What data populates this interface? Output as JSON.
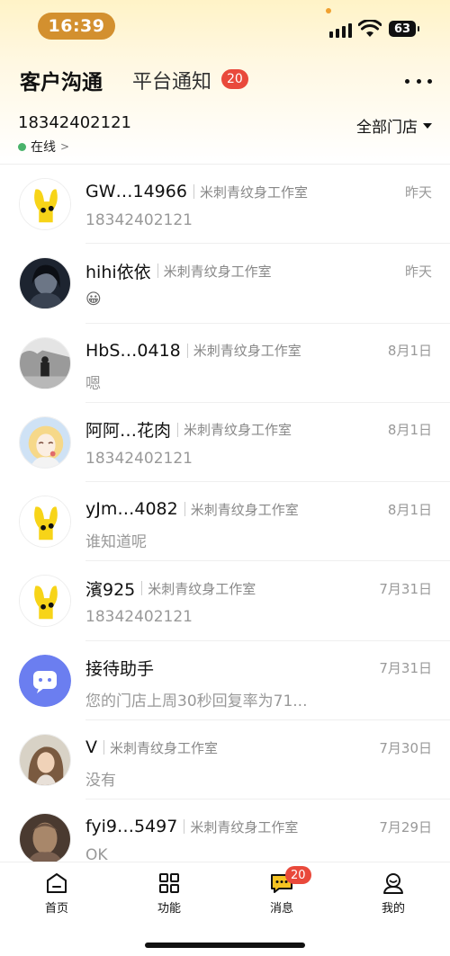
{
  "status_bar": {
    "time": "16:39",
    "battery": "63"
  },
  "tabs": {
    "active": "客户沟通",
    "inactive": "平台通知",
    "badge": "20"
  },
  "account": {
    "phone": "18342402121",
    "status": "在线",
    "store_selector": "全部门店"
  },
  "conversations": [
    {
      "name": "GW…14966",
      "store": "米刺青纹身工作室",
      "date": "昨天",
      "message": "18342402121",
      "avatar": "yellow-hand-avatar"
    },
    {
      "name": "hihi依依",
      "store": "米刺青纹身工作室",
      "date": "昨天",
      "message": "😀",
      "avatar": "dark-portrait-avatar"
    },
    {
      "name": "HbS…0418",
      "store": "米刺青纹身工作室",
      "date": "8月1日",
      "message": "嗯",
      "avatar": "street-photo-avatar"
    },
    {
      "name": "阿阿…花肉",
      "store": "米刺青纹身工作室",
      "date": "8月1日",
      "message": "18342402121",
      "avatar": "illustration-girl-avatar"
    },
    {
      "name": "yJm…4082",
      "store": "米刺青纹身工作室",
      "date": "8月1日",
      "message": "谁知道呢",
      "avatar": "yellow-hand-avatar"
    },
    {
      "name": "濱925",
      "store": "米刺青纹身工作室",
      "date": "7月31日",
      "message": "18342402121",
      "avatar": "yellow-hand-avatar"
    },
    {
      "name": "接待助手",
      "store": "",
      "date": "7月31日",
      "message": "您的门店上周30秒回复率为71...",
      "avatar": "assistant-chat-avatar"
    },
    {
      "name": "V",
      "store": "米刺青纹身工作室",
      "date": "7月30日",
      "message": "没有",
      "avatar": "woman-photo-avatar"
    },
    {
      "name": "fyi9…5497",
      "store": "米刺青纹身工作室",
      "date": "7月29日",
      "message": "OK",
      "avatar": "statue-photo-avatar"
    }
  ],
  "bottom_nav": {
    "home": "首页",
    "functions": "功能",
    "messages": "消息",
    "messages_badge": "20",
    "mine": "我的"
  },
  "colors": {
    "accent_orange": "#d3902f",
    "badge_red": "#e9493b",
    "online_green": "#49b36a",
    "assistant_blue": "#6b7ef0"
  }
}
